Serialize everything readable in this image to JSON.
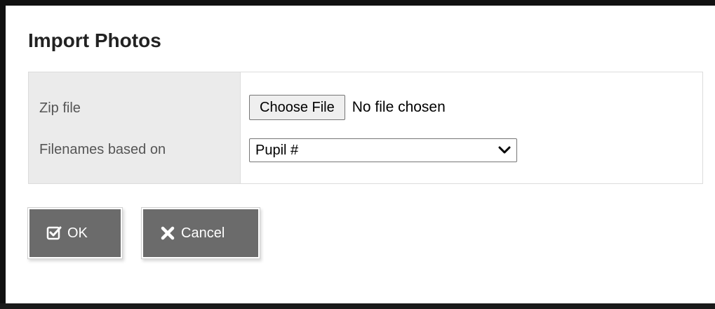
{
  "dialog": {
    "title": "Import Photos",
    "fields": {
      "zip_label": "Zip file",
      "file_button": "Choose File",
      "file_status": "No file chosen",
      "filenames_label": "Filenames based on",
      "filenames_value": "Pupil #"
    },
    "buttons": {
      "ok": "OK",
      "cancel": "Cancel"
    }
  },
  "icons": {
    "ok": "check-square-icon",
    "cancel": "close-x-icon",
    "select": "chevron-down-icon"
  },
  "colors": {
    "button_bg": "#6b6b6b",
    "label_bg": "#ebebeb",
    "title": "#222222"
  }
}
